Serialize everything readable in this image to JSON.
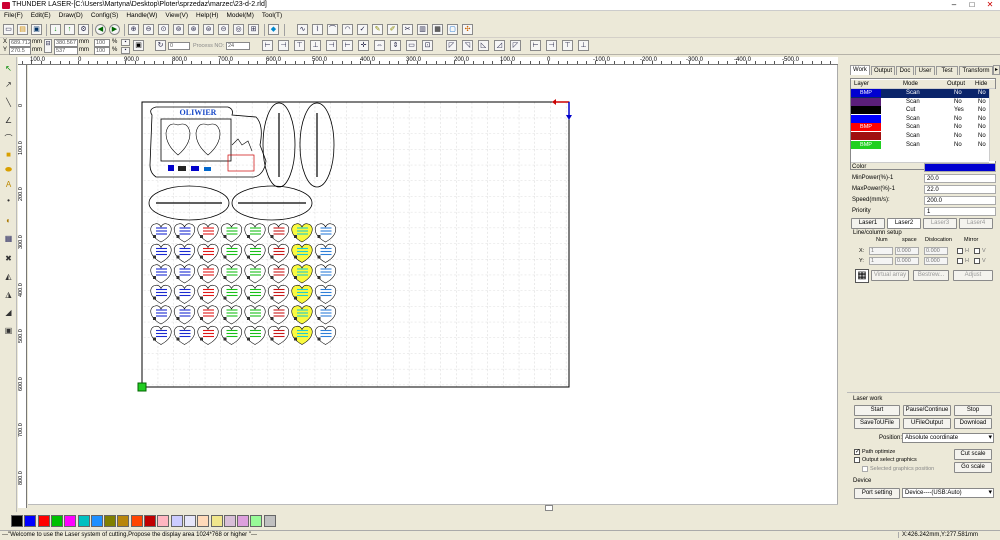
{
  "title": "THUNDER LASER-[C:\\Users\\Martyna\\Desktop\\Ploter\\sprzedaz\\marzec\\23-d-2.rld]",
  "menu": [
    "File(F)",
    "Edit(E)",
    "Draw(D)",
    "Config(S)",
    "Handle(W)",
    "View(V)",
    "Help(H)",
    "Model(M)",
    "Tool(T)"
  ],
  "coords": {
    "x_label": "X",
    "y_label": "Y",
    "x_value": "689.712",
    "y_value": "270.5",
    "x_unit": "mm",
    "y_unit": "mm",
    "w_value": "380.567",
    "h_value": "537",
    "w_unit": "mm",
    "h_unit": "mm",
    "pct1": "100",
    "pct2": "100",
    "pct_unit": "%",
    "rotate_value": "0",
    "process_label": "Process NO:",
    "process_value": "24"
  },
  "rulers": {
    "h": [
      "100.0",
      "0",
      "900.0",
      "800.0",
      "700.0",
      "600.0",
      "500.0",
      "400.0",
      "300.0",
      "200.0",
      "100.0",
      "0",
      "-100.0",
      "-200.0",
      "-300.0",
      "-400.0",
      "-500.0"
    ],
    "v": [
      "0",
      "100.0",
      "200.0",
      "300.0",
      "400.0",
      "500.0",
      "600.0",
      "700.0",
      "800.0"
    ]
  },
  "design": {
    "brand": "OLIWIER"
  },
  "panel": {
    "tabs": [
      "Work",
      "Output",
      "Doc",
      "User",
      "Test",
      "Transform"
    ],
    "layer_headers": [
      "Layer",
      "Mode",
      "Output",
      "Hide"
    ],
    "layers": [
      {
        "color": "#0000d0",
        "label": "BMP",
        "mode": "Scan",
        "output": "No",
        "hide": "No",
        "selected": true
      },
      {
        "color": "#5a1e7a",
        "label": "",
        "mode": "Scan",
        "output": "No",
        "hide": "No",
        "selected": false
      },
      {
        "color": "#000000",
        "label": "",
        "mode": "Cut",
        "output": "Yes",
        "hide": "No",
        "selected": false
      },
      {
        "color": "#0000ff",
        "label": "",
        "mode": "Scan",
        "output": "No",
        "hide": "No",
        "selected": false
      },
      {
        "color": "#ff0000",
        "label": "BMP",
        "mode": "Scan",
        "output": "No",
        "hide": "No",
        "selected": false
      },
      {
        "color": "#a01010",
        "label": "",
        "mode": "Scan",
        "output": "No",
        "hide": "No",
        "selected": false
      },
      {
        "color": "#20d020",
        "label": "BMP",
        "mode": "Scan",
        "output": "No",
        "hide": "No",
        "selected": false
      }
    ],
    "props": {
      "color_label": "Color",
      "color_value": "#0000d0",
      "minpower_label": "MinPower(%)-1",
      "minpower_value": "20.0",
      "maxpower_label": "MaxPower(%)-1",
      "maxpower_value": "22.0",
      "speed_label": "Speed(mm/s):",
      "speed_value": "200.0",
      "priority_label": "Priority",
      "priority_value": "1"
    },
    "laser_tabs": [
      "Laser1",
      "Laser2",
      "Laser3",
      "Laser4"
    ],
    "linecol": {
      "title": "Line/column setup",
      "headers": [
        "Num",
        "space",
        "Dislocation",
        "Mirror"
      ],
      "x_label": "X:",
      "y_label": "Y:",
      "x_num": "1",
      "x_space": "0.000",
      "x_disloc": "0.000",
      "y_num": "1",
      "y_space": "0.000",
      "y_disloc": "0.000",
      "h": "H",
      "v": "V",
      "virtual_array": "Virtual array",
      "bestrew": "Bestrew...",
      "adjust": "Adjust"
    }
  },
  "laserwork": {
    "title": "Laser work",
    "start": "Start",
    "pause": "Pause/Continue",
    "stop": "Stop",
    "savetoufile": "SaveToUFile",
    "ufileoutput": "UFileOutput",
    "download": "Download",
    "position_label": "Position:",
    "position_value": "Absolute coordinate",
    "path_optimize": "Path optimize",
    "output_select": "Output select graphics",
    "selected_pos": "Selected graphics position",
    "cut_scale": "Cut scale",
    "go_scale": "Go scale",
    "device_title": "Device",
    "port_setting": "Port setting",
    "device_value": "Device----(USB:Auto)"
  },
  "palette": [
    "#000000",
    "#0000ff",
    "#ff0000",
    "#00c000",
    "#ff00ff",
    "#00c0c0",
    "#1e90ff",
    "#808000",
    "#b8860b",
    "#ff4500",
    "#c00000",
    "#ffb6c1",
    "#ccccff",
    "#e6e6fa",
    "#ffdab9",
    "#f0e68c",
    "#d8bfd8",
    "#dda0dd",
    "#98fb98",
    "#c0c0c0"
  ],
  "status": {
    "message": "---\"Welcome to use the Laser system of cutting,Propose the display area 1024*768 or higher \"---",
    "coords": "X:426.242mm,Y:277.581mm"
  }
}
